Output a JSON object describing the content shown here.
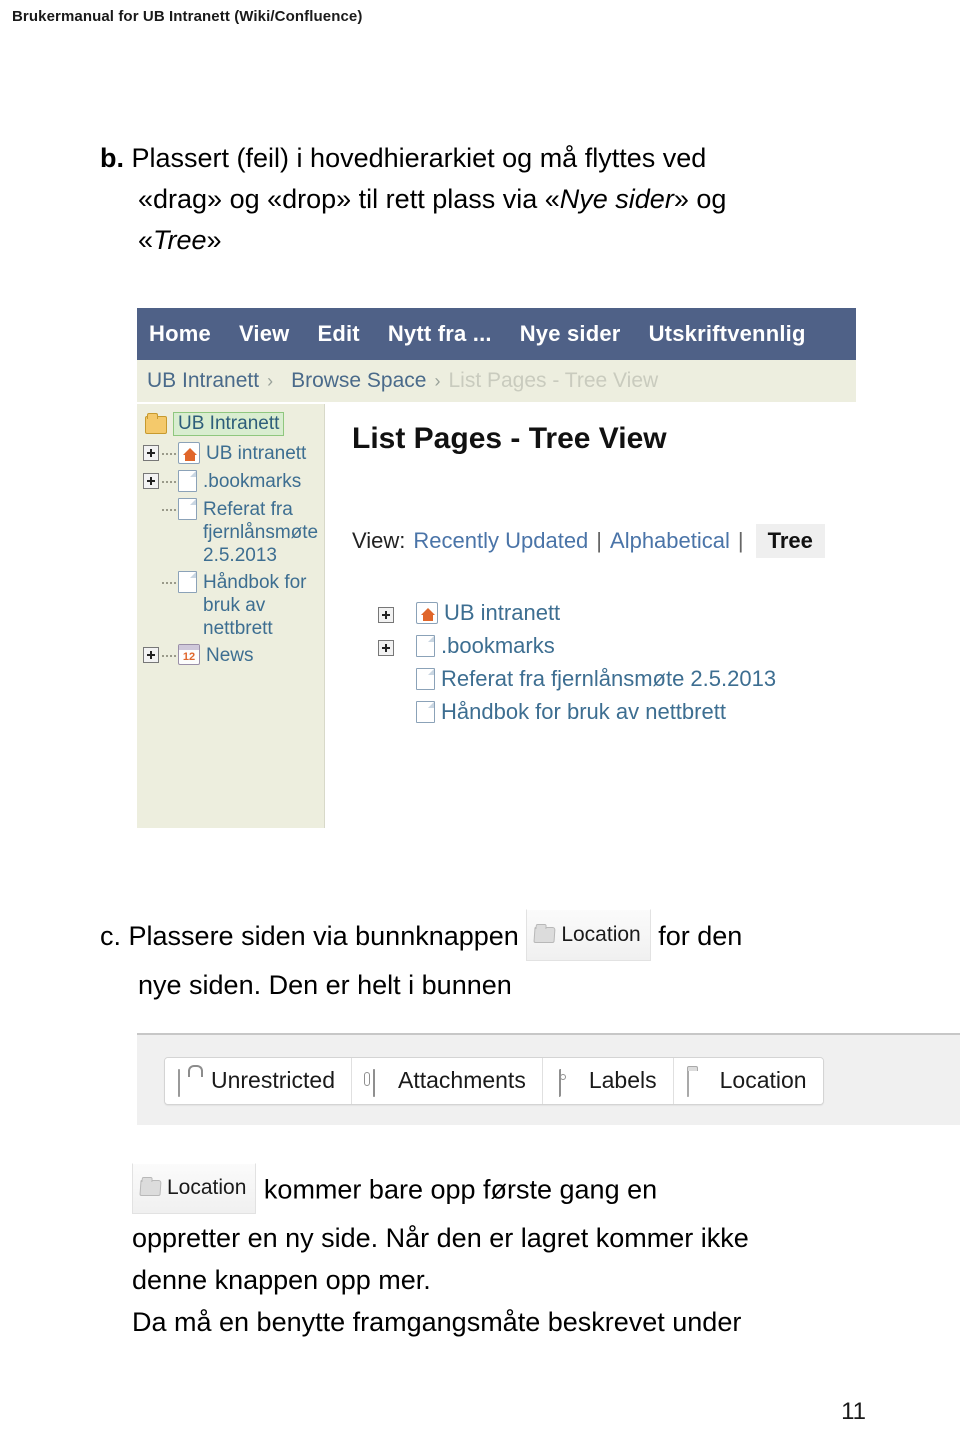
{
  "document": {
    "running_header": "Brukermanual for UB Intranett (Wiki/Confluence)",
    "page_number": "11"
  },
  "section_b": {
    "marker": "b.",
    "line1": "Plassert (feil) i hovedhierarkiet og må flyttes ved",
    "line2_pre": "«drag» og «drop» til rett plass via «",
    "line2_italic": "Nye sider",
    "line2_post": "» og",
    "line3_open": "«",
    "line3_italic": "Tree",
    "line3_close": "»"
  },
  "screenshot_tree": {
    "nav_items": [
      "Home",
      "View",
      "Edit",
      "Nytt fra ...",
      "Nye sider",
      "Utskriftvennlig"
    ],
    "breadcrumb": {
      "root": "UB Intranett",
      "separator": "›",
      "middle": "Browse Space",
      "current": "List Pages - Tree View"
    },
    "sidebar": {
      "root_label": "UB Intranett",
      "root_icon": "folder-icon",
      "items": [
        {
          "label": "UB intranett",
          "icon": "home-page-icon",
          "expandable": true
        },
        {
          "label": ".bookmarks",
          "icon": "page-icon",
          "expandable": true
        },
        {
          "label": "Referat fra fjernlånsmøte 2.5.2013",
          "icon": "page-icon",
          "expandable": false
        },
        {
          "label": "Håndbok for bruk av nettbrett",
          "icon": "page-icon",
          "expandable": false
        },
        {
          "label": "News",
          "icon": "calendar-icon",
          "icon_number": "12",
          "expandable": true
        }
      ]
    },
    "main": {
      "title": "List Pages - Tree View",
      "view_label": "View:",
      "view_options": [
        "Recently Updated",
        "Alphabetical"
      ],
      "view_active": "Tree",
      "separator": "|",
      "tree_items": [
        {
          "label": "UB intranett",
          "icon": "home-page-icon",
          "expandable": true
        },
        {
          "label": ".bookmarks",
          "icon": "page-icon",
          "expandable": true
        },
        {
          "label": "Referat fra fjernlånsmøte 2.5.2013",
          "icon": "page-icon",
          "expandable": false
        },
        {
          "label": "Håndbok for bruk av nettbrett",
          "icon": "page-icon",
          "expandable": false
        }
      ]
    }
  },
  "section_c": {
    "marker": "c.",
    "line1_pre": "Plassere siden via bunnknappen",
    "button_label": "Location",
    "button_icon": "folder-icon",
    "line1_post": "for den",
    "line2": "nye siden.  Den er helt i bunnen"
  },
  "screenshot_buttonbar": {
    "buttons": [
      {
        "label": "Unrestricted",
        "icon": "unlocked-padlock-icon"
      },
      {
        "label": "Attachments",
        "icon": "paperclip-icon"
      },
      {
        "label": "Labels",
        "icon": "tag-icon"
      },
      {
        "label": "Location",
        "icon": "folder-icon"
      }
    ]
  },
  "section_d": {
    "button_label": "Location",
    "button_icon": "folder-icon",
    "line1_after_button": "kommer bare opp første gang en",
    "line2": "oppretter en ny side.  Når den er lagret kommer ikke",
    "line3": "denne knappen opp mer.",
    "line4": "Da må en benytte framgangsmåte beskrevet under"
  },
  "colors": {
    "nav_background": "#4f6187",
    "breadcrumb_background": "#edeedf",
    "sidebar_background": "#edeede",
    "link_blue": "#3d6e91",
    "selected_green": "#d9edd0",
    "buttonbar_background": "#f0f0f0"
  }
}
